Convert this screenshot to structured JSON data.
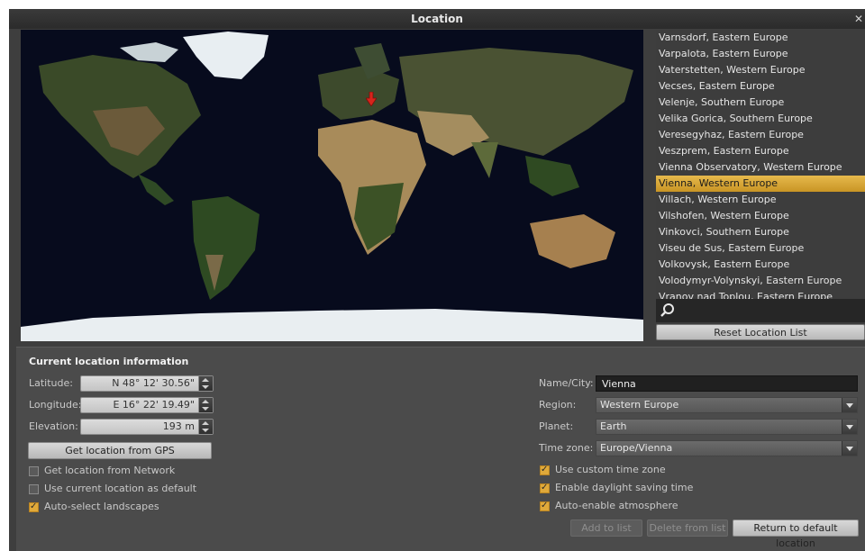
{
  "window": {
    "title": "Location"
  },
  "map": {
    "description_icon": "location-pin-icon"
  },
  "city_list": {
    "items": [
      "Varnsdorf, Eastern Europe",
      "Varpalota, Eastern Europe",
      "Vaterstetten, Western Europe",
      "Vecses, Eastern Europe",
      "Velenje, Southern Europe",
      "Velika Gorica, Southern Europe",
      "Veresegyhaz, Eastern Europe",
      "Veszprem, Eastern Europe",
      "Vienna Observatory, Western Europe",
      "Vienna, Western Europe",
      "Villach, Western Europe",
      "Vilshofen, Western Europe",
      "Vinkovci, Southern Europe",
      "Viseu de Sus, Eastern Europe",
      "Volkovysk, Eastern Europe",
      "Volodymyr-Volynskyi, Eastern Europe",
      "Vranov nad Toplou, Eastern Europe"
    ],
    "selected_index": 9,
    "reset_label": "Reset Location List"
  },
  "current": {
    "heading": "Current location information",
    "latitude_label": "Latitude:",
    "latitude_value": "N 48° 12' 30.56\"",
    "longitude_label": "Longitude:",
    "longitude_value": "E 16° 22' 19.49\"",
    "elevation_label": "Elevation:",
    "elevation_value": "193 m",
    "gps_button": "Get location from GPS",
    "cb_network": "Get location from Network",
    "cb_default": "Use current location as default",
    "cb_landscapes": "Auto-select landscapes"
  },
  "right": {
    "name_label": "Name/City:",
    "name_value": "Vienna",
    "region_label": "Region:",
    "region_value": "Western Europe",
    "planet_label": "Planet:",
    "planet_value": "Earth",
    "tz_label": "Time zone:",
    "tz_value": "Europe/Vienna",
    "cb_custom_tz": "Use custom time zone",
    "cb_dst": "Enable daylight saving time",
    "cb_atmosphere": "Auto-enable atmosphere",
    "add_label": "Add to list",
    "delete_label": "Delete from list",
    "return_label": "Return to default location"
  },
  "colors": {
    "selection": "#d9a83c",
    "accent_checkbox": "#e0a93a",
    "window_bg": "#3e3e3e"
  }
}
